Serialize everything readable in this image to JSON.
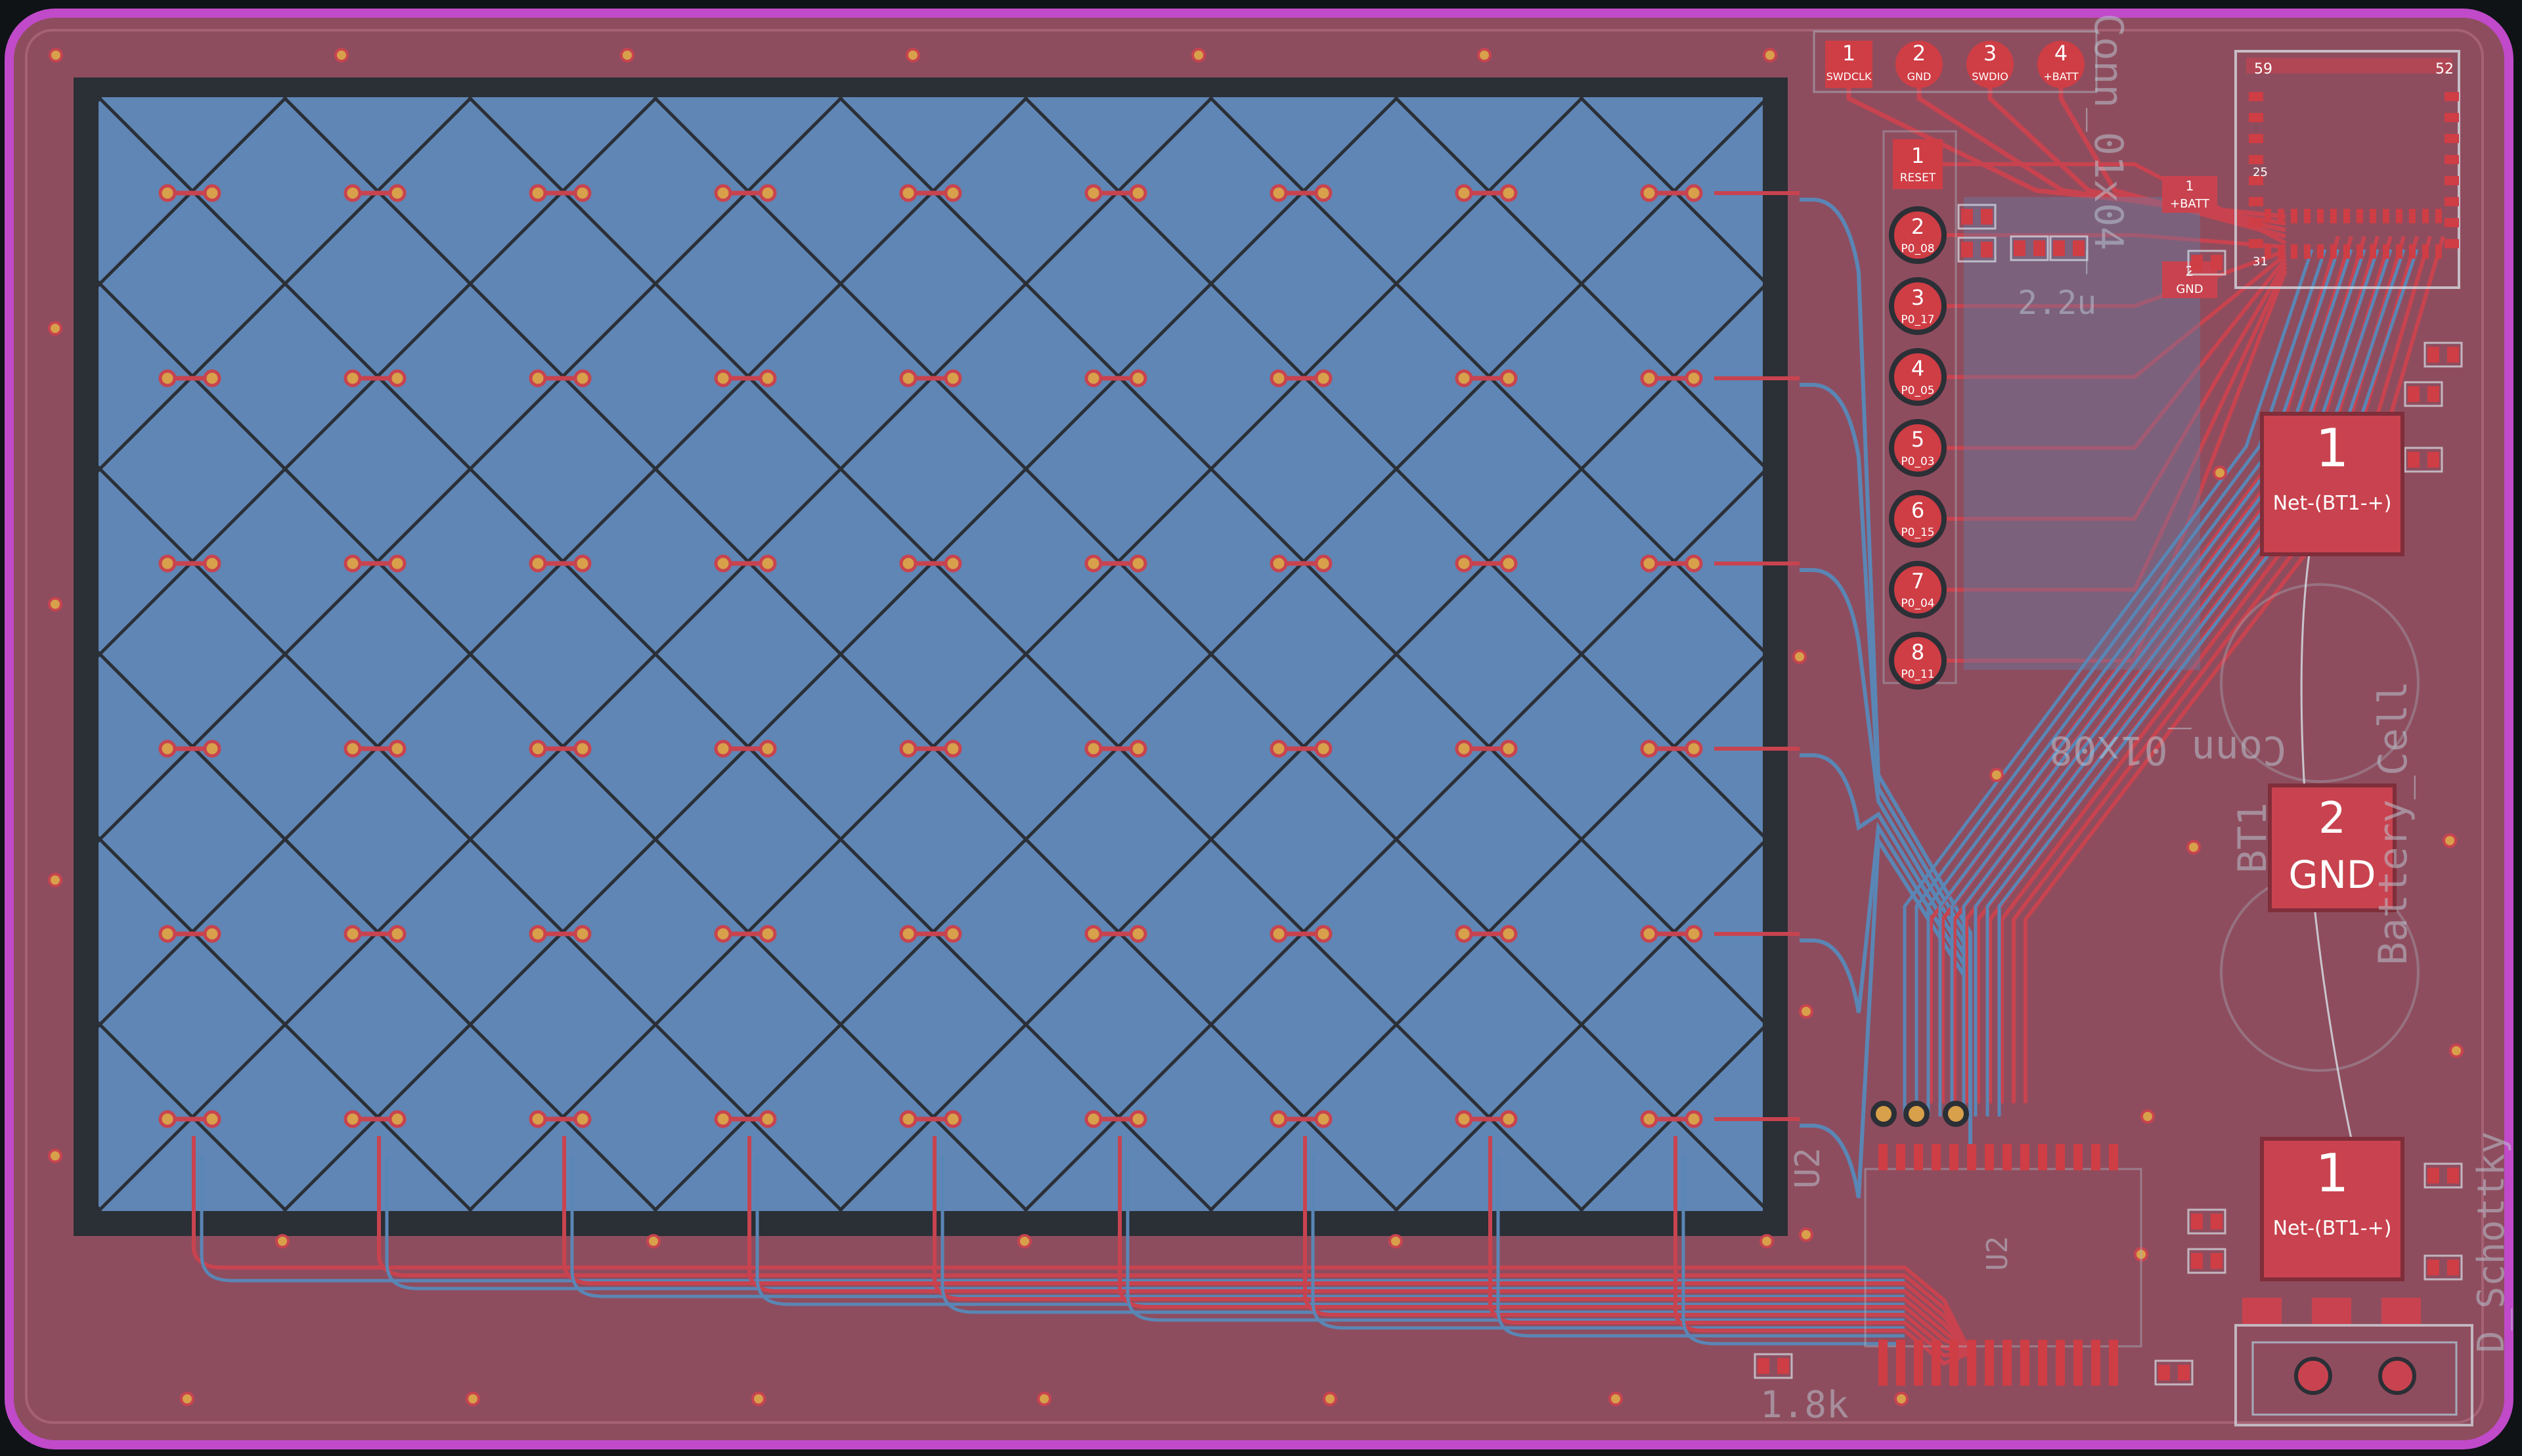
{
  "colors": {
    "background": "#0f1316",
    "board_outline": "#c04ac9",
    "board_fill": "#8e4d5e",
    "front_copper": "#c8434f",
    "back_copper": "#5a86b5",
    "touchpad_fill": "#5f86b5",
    "via": "#d8a04a",
    "pad": "#cf3d45"
  },
  "header_top": {
    "pins": [
      {
        "num": "1",
        "name": "SWDCLK"
      },
      {
        "num": "2",
        "name": "GND"
      },
      {
        "num": "3",
        "name": "SWDIO"
      },
      {
        "num": "4",
        "name": "+BATT"
      }
    ]
  },
  "header_side": {
    "pins": [
      {
        "num": "1",
        "name": "RESET"
      },
      {
        "num": "2",
        "name": "P0_08"
      },
      {
        "num": "3",
        "name": "P0_17"
      },
      {
        "num": "4",
        "name": "P0_05"
      },
      {
        "num": "5",
        "name": "P0_03"
      },
      {
        "num": "6",
        "name": "P0_15"
      },
      {
        "num": "7",
        "name": "P0_04"
      },
      {
        "num": "8",
        "name": "P0_11"
      }
    ]
  },
  "module": {
    "pin_tl": "59",
    "pin_tr": "52",
    "pin_ml": "25",
    "pin_bl": "31"
  },
  "small_pads": {
    "batt_num": "1",
    "batt_name": "+BATT",
    "gnd_num": "2",
    "gnd_name": "GND"
  },
  "battery": {
    "pad1_num": "1",
    "pad1_name": "Net-(BT1-+)",
    "pad2_num": "2",
    "pad2_name": "GND",
    "pad3_num": "1",
    "pad3_name": "Net-(BT1-+)"
  },
  "silkscreen": {
    "conn_top": "Conn_01x04_",
    "conn_mid": "Conn_01x08",
    "cap_value": "2.2u",
    "bt_ref": "BT1",
    "bt_value": "Battery_Cell",
    "diode_value": "D_Schottky",
    "res_value": "1.8k",
    "u2_ref": "U2",
    "ic_ref": "U2"
  },
  "touchpad": {
    "rows": 6,
    "cols": 9
  }
}
